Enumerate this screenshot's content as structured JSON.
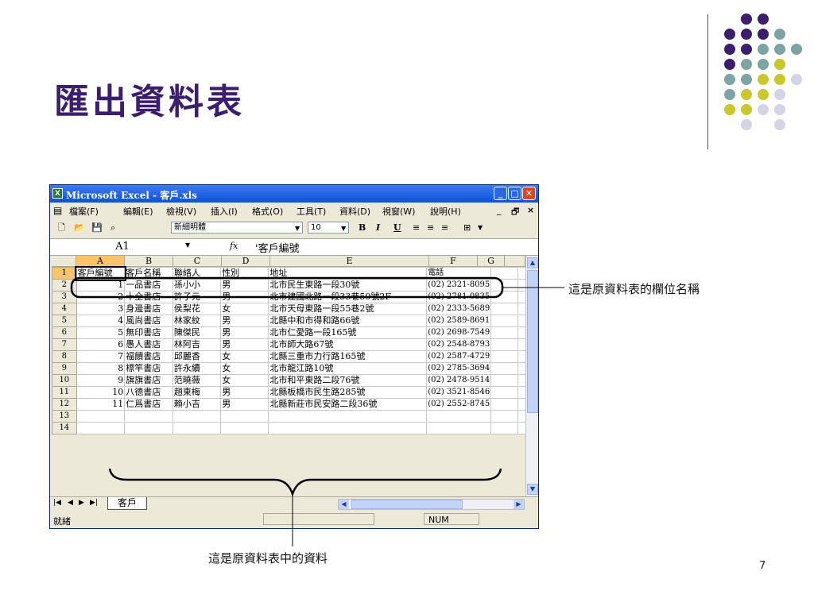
{
  "slide": {
    "title": "匯出資料表",
    "page_number": "7",
    "dot_colors": {
      "purple": "#3b1e6e",
      "teal": "#7ea3a3",
      "yellow": "#c9c72a",
      "lavender": "#d5d3e6"
    }
  },
  "window": {
    "title": "Microsoft Excel - 客戶.xls",
    "controls": {
      "minimize": "_",
      "maximize": "□",
      "close": "✕"
    },
    "doc_controls": {
      "minimize": "_",
      "restore": "🗗",
      "close": "×"
    }
  },
  "menu": [
    "檔案(F)",
    "編輯(E)",
    "檢視(V)",
    "插入(I)",
    "格式(O)",
    "工具(T)",
    "資料(D)",
    "視窗(W)",
    "說明(H)"
  ],
  "toolbar": {
    "font_name": "新細明體",
    "font_size": "10",
    "bold": "B",
    "italic": "I",
    "underline": "U"
  },
  "formula_bar": {
    "name_box": "A1",
    "fx": "fx",
    "value": "'客戶編號"
  },
  "sheet": {
    "columns": [
      "A",
      "B",
      "C",
      "D",
      "E",
      "F",
      "G"
    ],
    "rows": [
      {
        "n": "1",
        "cells": [
          "客戶編號",
          "客戶名稱",
          "聯絡人",
          "性別",
          "地址",
          "電話",
          ""
        ]
      },
      {
        "n": "2",
        "cells": [
          "1",
          "一品書店",
          "孫小小",
          "男",
          "北市民生東路一段30號",
          "(02) 2321-8095",
          ""
        ]
      },
      {
        "n": "3",
        "cells": [
          "2",
          "十全書店",
          "許子元",
          "男",
          "北市建國北路一段33巷50號2F",
          "(02) 2781-0835",
          ""
        ]
      },
      {
        "n": "4",
        "cells": [
          "3",
          "身邊書店",
          "侯梨花",
          "女",
          "北市天母東路一段55巷2號",
          "(02) 2333-5689",
          ""
        ]
      },
      {
        "n": "5",
        "cells": [
          "4",
          "風尚書店",
          "林家紋",
          "男",
          "北縣中和市得和路66號",
          "(02) 2589-8691",
          ""
        ]
      },
      {
        "n": "6",
        "cells": [
          "5",
          "無印書店",
          "陳傑民",
          "男",
          "北市仁愛路一段165號",
          "(02) 2698-7549",
          ""
        ]
      },
      {
        "n": "7",
        "cells": [
          "6",
          "愚人書店",
          "林阿吉",
          "男",
          "北市師大路67號",
          "(02) 2548-8793",
          ""
        ]
      },
      {
        "n": "8",
        "cells": [
          "7",
          "福饋書店",
          "邱麗香",
          "女",
          "北縣三重市力行路165號",
          "(02) 2587-4729",
          ""
        ]
      },
      {
        "n": "9",
        "cells": [
          "8",
          "標竿書店",
          "許永續",
          "女",
          "北市龍江路10號",
          "(02) 2785-3694",
          ""
        ]
      },
      {
        "n": "10",
        "cells": [
          "9",
          "旗旗書店",
          "范曉薇",
          "女",
          "北市和平東路二段76號",
          "(02) 2478-9514",
          ""
        ]
      },
      {
        "n": "11",
        "cells": [
          "10",
          "八德書店",
          "趙東梅",
          "男",
          "北縣板橋市民生路285號",
          "(02) 3521-8546",
          ""
        ]
      },
      {
        "n": "12",
        "cells": [
          "11",
          "仁爲書店",
          "賴小吉",
          "男",
          "北縣新莊市民安路二段36號",
          "(02) 2552-8745",
          ""
        ]
      },
      {
        "n": "13",
        "cells": [
          "",
          "",
          "",
          "",
          "",
          "",
          ""
        ]
      },
      {
        "n": "14",
        "cells": [
          "",
          "",
          "",
          "",
          "",
          "",
          ""
        ]
      }
    ],
    "tab_name": "客戶",
    "status": "就緒",
    "num_indicator": "NUM"
  },
  "annotations": {
    "header_note": "這是原資料表的欄位名稱",
    "data_note": "這是原資料表中的資料"
  }
}
